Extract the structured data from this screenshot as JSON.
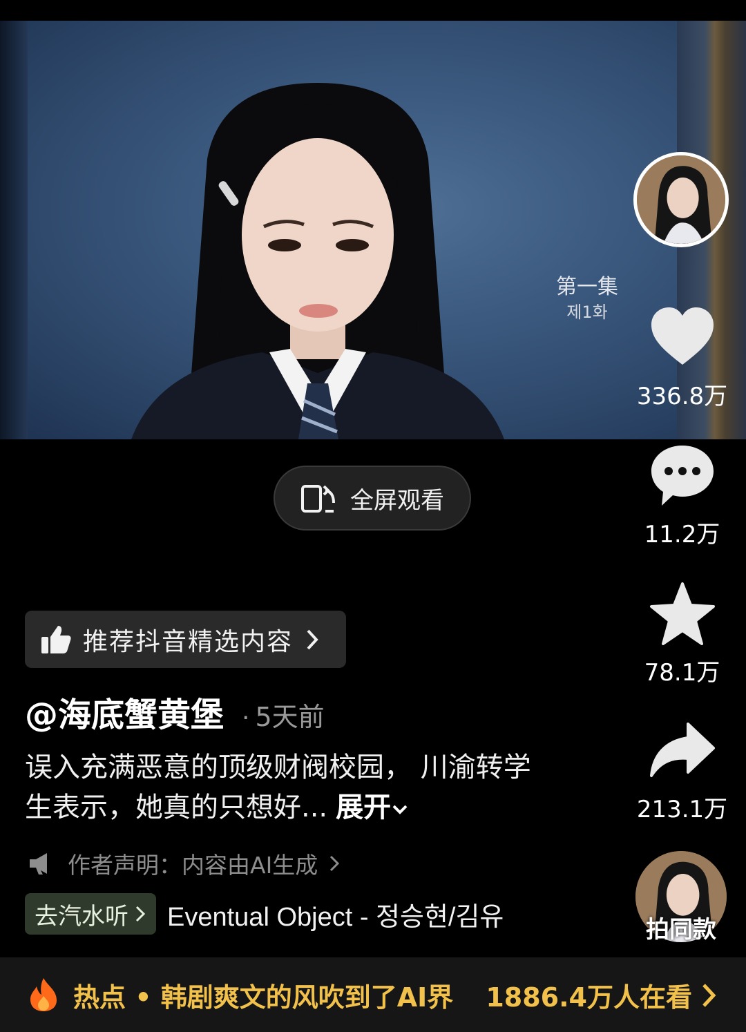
{
  "video": {
    "episode_title": "第一集",
    "episode_subtitle": "제1화"
  },
  "actions": {
    "like_count": "336.8万",
    "comment_count": "11.2万",
    "favorite_count": "78.1万",
    "share_count": "213.1万"
  },
  "fullscreen": {
    "label": "全屏观看"
  },
  "recommend": {
    "label": "推荐抖音精选内容"
  },
  "post": {
    "author": "@海底蟹黄堡",
    "separator": "·",
    "time_ago": "5天前",
    "description": "误入充满恶意的顶级财阀校园， 川渝转学生表示，她真的只想好...",
    "expand_label": "展开",
    "statement": "作者声明：内容由AI生成"
  },
  "music": {
    "soda_label": "去汽水听",
    "song": "Eventual Object - 정승현/김유"
  },
  "shoot_same": {
    "label": "拍同款"
  },
  "hot": {
    "text": "热点 • 韩剧爽文的风吹到了AI界",
    "watching": "1886.4万人在看"
  },
  "colors": {
    "hot_text": "#f2c14b",
    "background": "#000000"
  }
}
